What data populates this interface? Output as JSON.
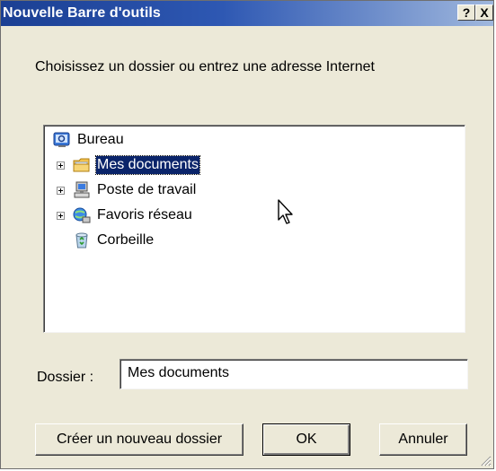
{
  "window": {
    "title": "Nouvelle Barre d'outils",
    "help_label": "?",
    "close_label": "X"
  },
  "prompt": "Choisissez un dossier ou entrez une adresse Internet",
  "tree": {
    "items": [
      {
        "label": "Bureau",
        "icon": "desktop-icon",
        "expandable": false,
        "selected": false
      },
      {
        "label": "Mes documents",
        "icon": "folder-icon",
        "expandable": true,
        "selected": true
      },
      {
        "label": "Poste de travail",
        "icon": "computer-icon",
        "expandable": true,
        "selected": false
      },
      {
        "label": "Favoris réseau",
        "icon": "network-icon",
        "expandable": true,
        "selected": false
      },
      {
        "label": "Corbeille",
        "icon": "recycle-bin-icon",
        "expandable": false,
        "selected": false
      }
    ]
  },
  "folder_field": {
    "label": "Dossier :",
    "value": "Mes documents"
  },
  "buttons": {
    "new_folder": "Créer un nouveau dossier",
    "ok": "OK",
    "cancel": "Annuler"
  },
  "colors": {
    "title_gradient_start": "#1b3f93",
    "title_gradient_end": "#9fb7dd",
    "selection": "#0a246a",
    "dialog_face": "#ece9d8"
  }
}
